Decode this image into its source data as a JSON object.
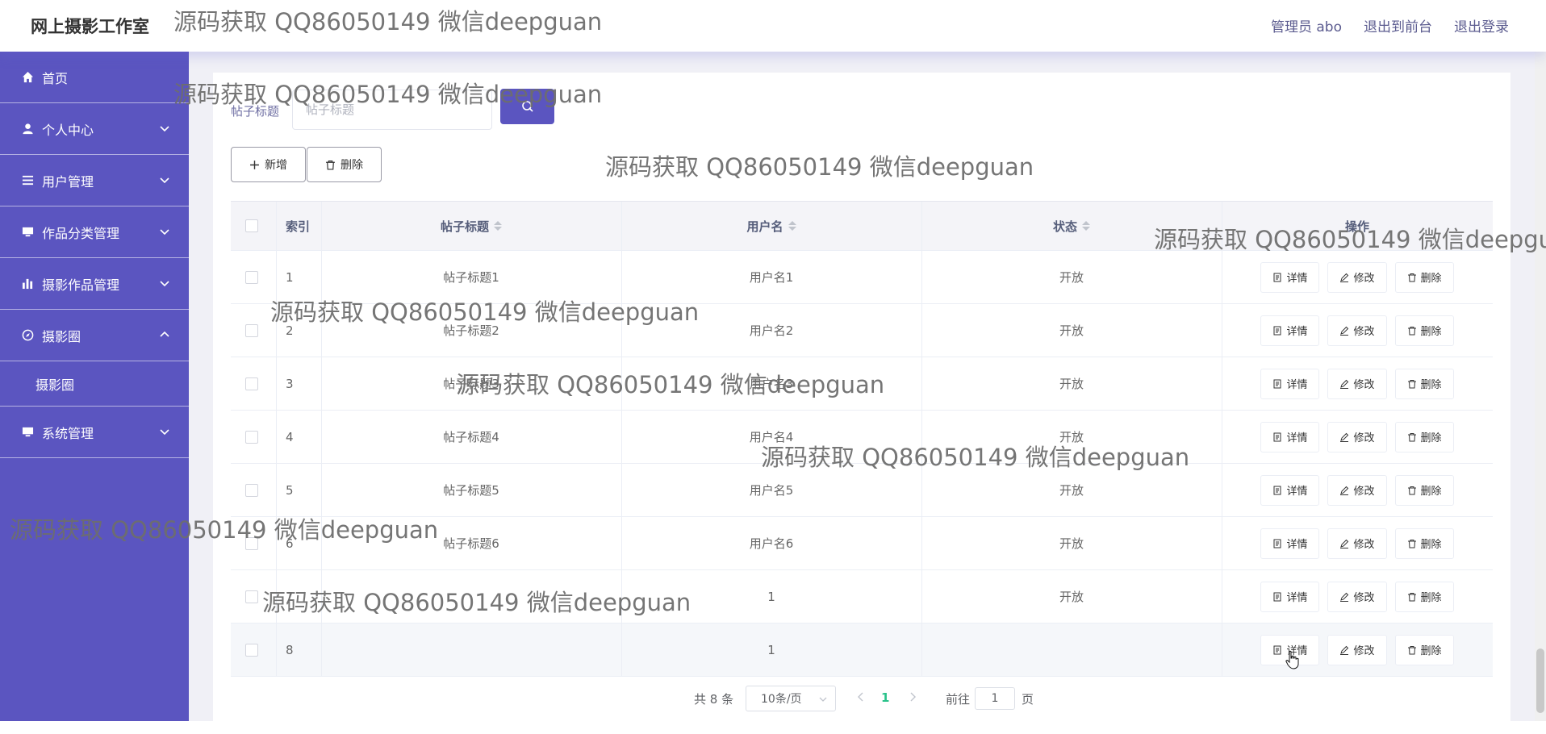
{
  "header": {
    "brand": "网上摄影工作室",
    "links": [
      "管理员 abo",
      "退出到前台",
      "退出登录"
    ]
  },
  "sidebar": {
    "items": [
      {
        "label": "首页",
        "icon": "home-icon"
      },
      {
        "label": "个人中心",
        "icon": "user-icon"
      },
      {
        "label": "用户管理",
        "icon": "list-icon"
      },
      {
        "label": "作品分类管理",
        "icon": "monitor-icon"
      },
      {
        "label": "摄影作品管理",
        "icon": "bar-chart-icon"
      },
      {
        "label": "摄影圈",
        "icon": "compass-icon"
      },
      {
        "label": "系统管理",
        "icon": "monitor-icon"
      }
    ],
    "sub_item": "摄影圈"
  },
  "search": {
    "label": "帖子标题",
    "placeholder": "帖子标题"
  },
  "toolbar": {
    "add_label": "新增",
    "delete_label": "删除"
  },
  "table": {
    "headers": {
      "index": "索引",
      "title": "帖子标题",
      "user": "用户名",
      "status": "状态",
      "ops": "操作"
    },
    "ops_labels": {
      "detail": "详情",
      "edit": "修改",
      "delete": "删除"
    },
    "rows": [
      {
        "index": "1",
        "title": "帖子标题1",
        "user": "用户名1",
        "status": "开放"
      },
      {
        "index": "2",
        "title": "帖子标题2",
        "user": "用户名2",
        "status": "开放"
      },
      {
        "index": "3",
        "title": "帖子标题3",
        "user": "用户名3",
        "status": "开放"
      },
      {
        "index": "4",
        "title": "帖子标题4",
        "user": "用户名4",
        "status": "开放"
      },
      {
        "index": "5",
        "title": "帖子标题5",
        "user": "用户名5",
        "status": "开放"
      },
      {
        "index": "6",
        "title": "帖子标题6",
        "user": "用户名6",
        "status": "开放"
      },
      {
        "index": "7",
        "title": "",
        "user": "1",
        "status": "开放"
      },
      {
        "index": "8",
        "title": "",
        "user": "1",
        "status": ""
      }
    ]
  },
  "pagination": {
    "total": "共 8 条",
    "page_size": "10条/页",
    "current": "1",
    "goto_label": "前往",
    "goto_value": "1",
    "page_unit": "页"
  },
  "watermark": "源码获取 QQ86050149 微信deepguan",
  "colors": {
    "sidebar_bg": "#5b55c0",
    "accent": "#5b55c0",
    "pager_current": "#29c28a"
  }
}
